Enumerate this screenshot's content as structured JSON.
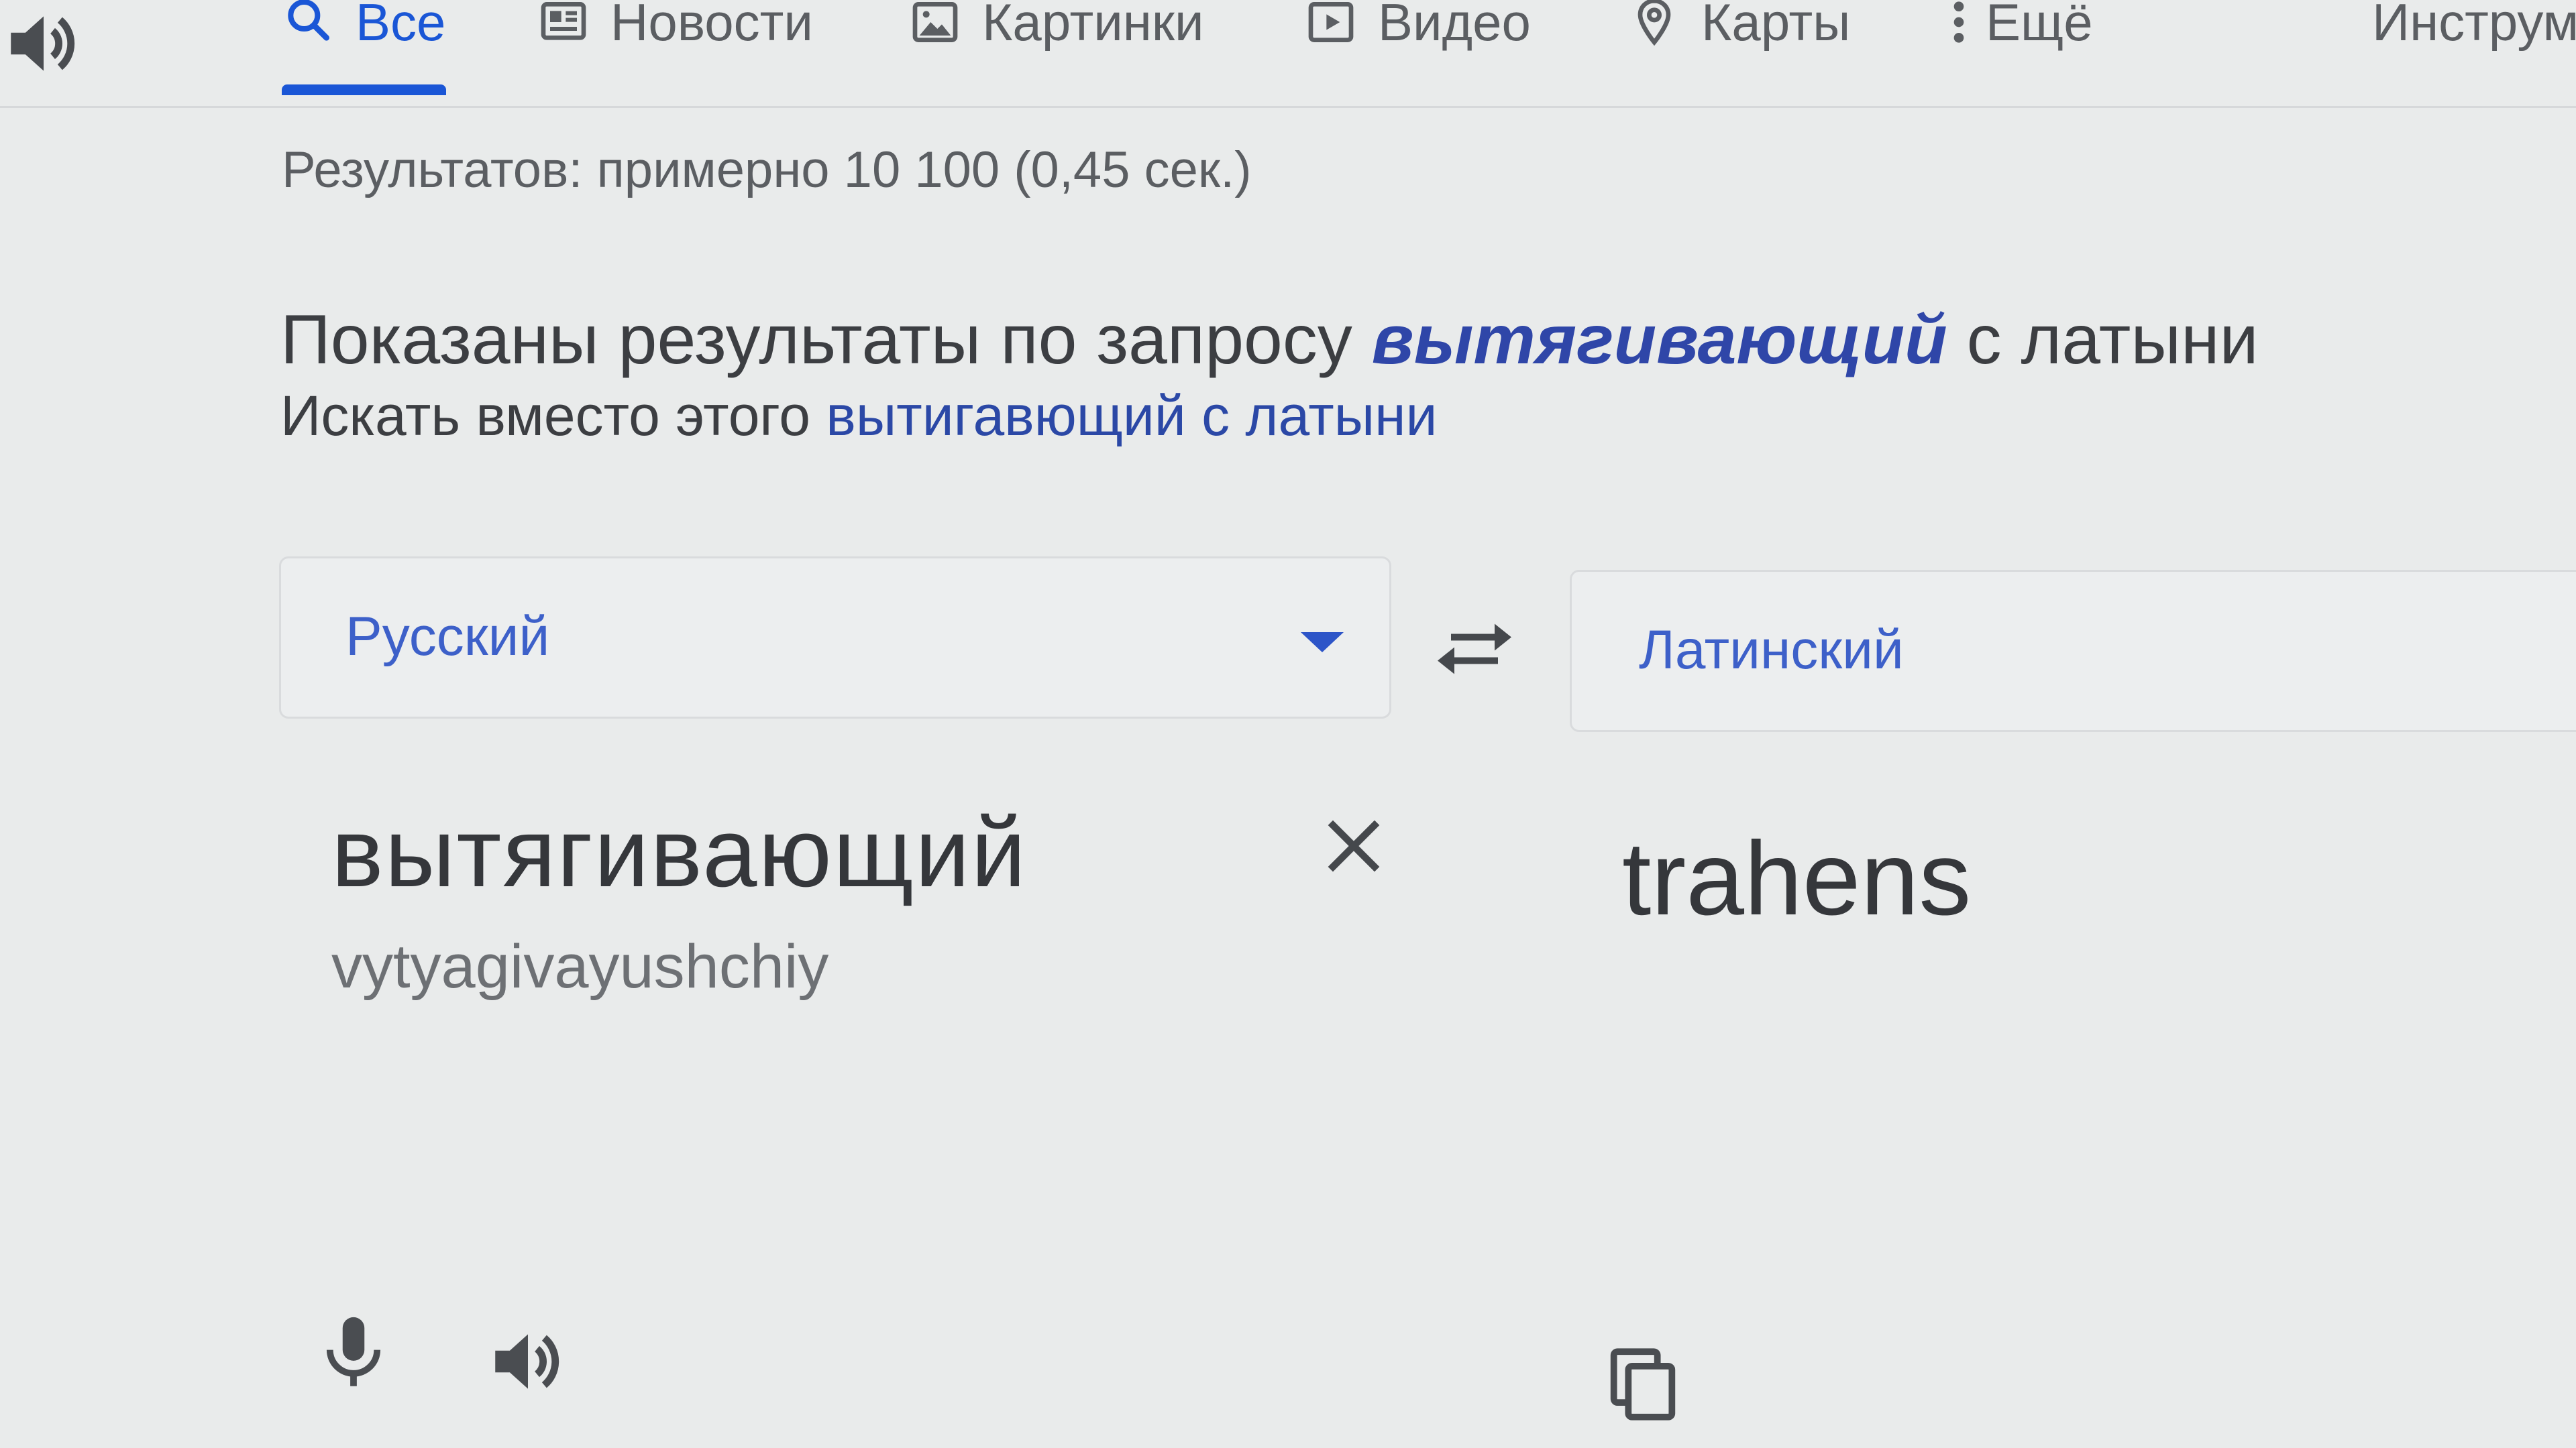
{
  "tabs": [
    {
      "label": "Все",
      "icon": "search-icon",
      "active": true
    },
    {
      "label": "Новости",
      "icon": "news-icon"
    },
    {
      "label": "Картинки",
      "icon": "image-icon"
    },
    {
      "label": "Видео",
      "icon": "video-icon"
    },
    {
      "label": "Карты",
      "icon": "map-pin-icon"
    },
    {
      "label": "Ещё",
      "icon": "more-vert-icon"
    },
    {
      "label": "Инструм"
    }
  ],
  "results_stats": "Результатов: примерно 10 100 (0,45 сек.)",
  "spelling": {
    "showing_prefix": "Показаны результаты по запросу",
    "corrected_query": "вытягивающий",
    "showing_suffix": "с латыни",
    "instead_prefix": "Искать вместо этого",
    "instead_link": "вытигавющий с латыни"
  },
  "translator": {
    "source_language": "Русский",
    "target_language": "Латинский",
    "source_text": "вытягивающий",
    "transliteration": "vytyagivayushchiy",
    "translation": "trahens"
  },
  "colors": {
    "accent": "#1a56d6",
    "link": "#2b48a6",
    "query_highlight": "#2f46a8",
    "background": "#e9ebeb"
  }
}
